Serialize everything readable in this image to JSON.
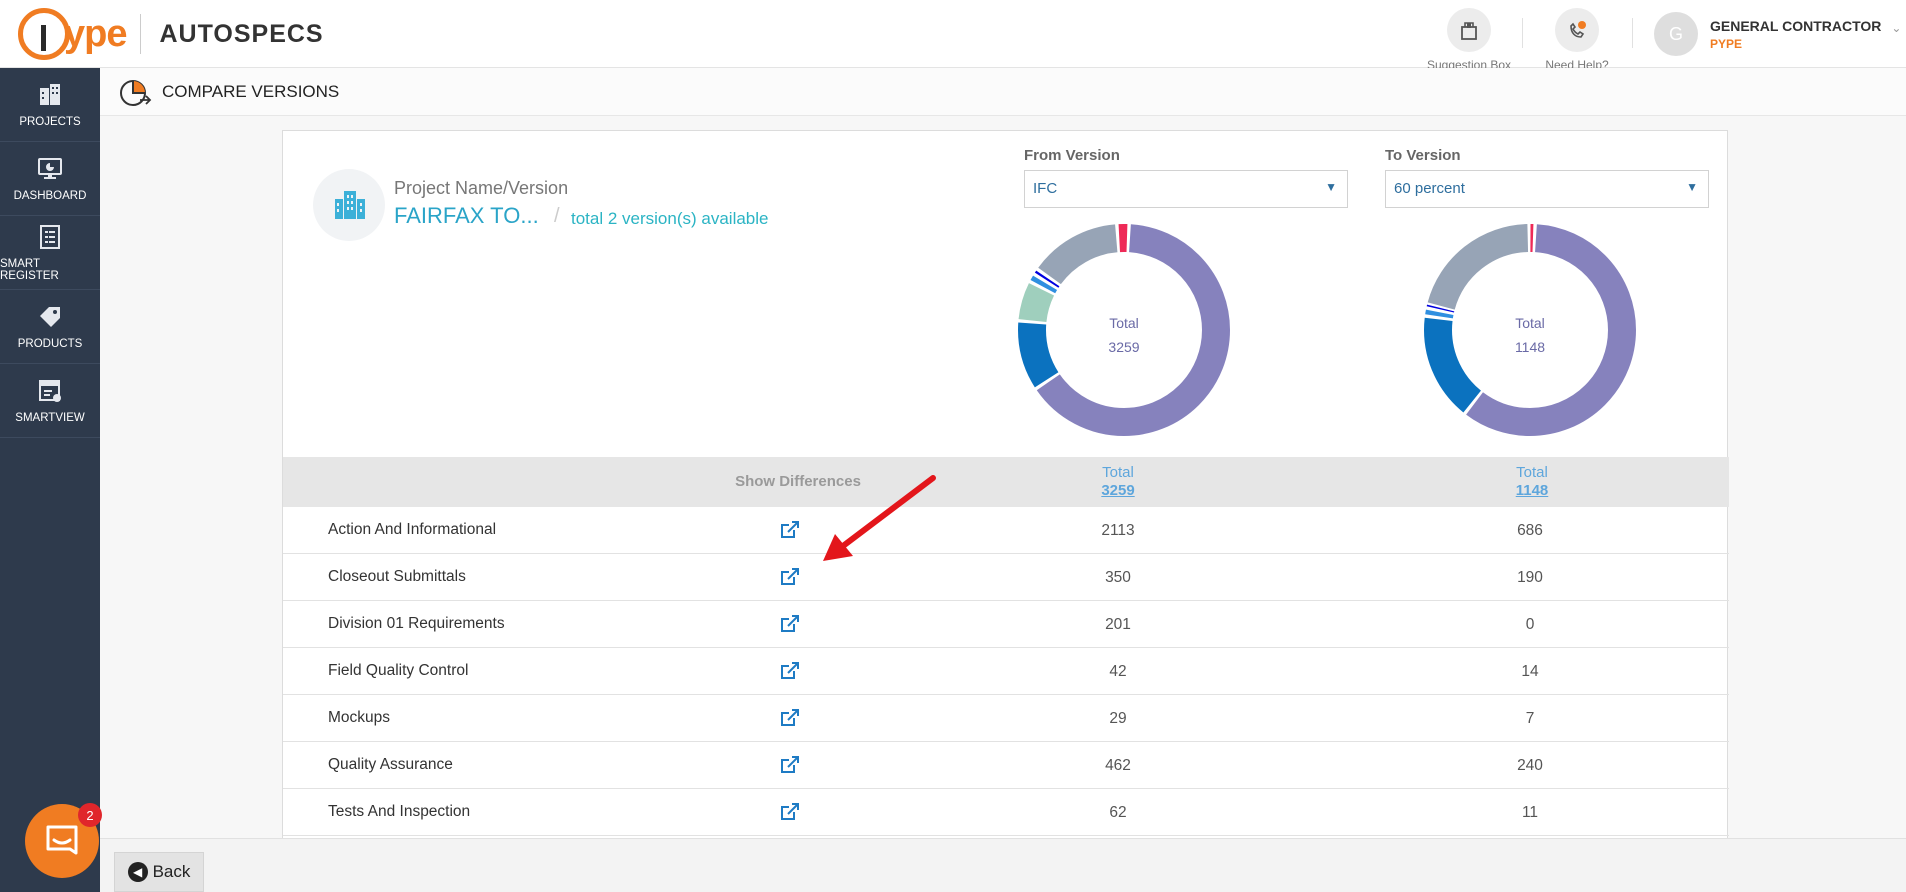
{
  "header": {
    "brand": "ype",
    "app_name": "AUTOSPECS",
    "actions": [
      {
        "label": "Suggestion Box",
        "icon": "suggestion-box-icon"
      },
      {
        "label": "Need Help?",
        "icon": "help-phone-icon"
      }
    ],
    "user": {
      "initial": "G",
      "name": "GENERAL CONTRACTOR",
      "org": "PYPE"
    }
  },
  "sidebar": {
    "items": [
      {
        "label": "PROJECTS",
        "icon": "building-icon"
      },
      {
        "label": "DASHBOARD",
        "icon": "monitor-icon"
      },
      {
        "label": "SMART REGISTER",
        "icon": "register-icon"
      },
      {
        "label": "PRODUCTS",
        "icon": "tag-icon"
      },
      {
        "label": "SMARTVIEW",
        "icon": "smartview-icon"
      }
    ]
  },
  "page": {
    "title": "COMPARE VERSIONS"
  },
  "project": {
    "label": "Project Name/Version",
    "name": "FAIRFAX TO...",
    "separator": "/",
    "total_versions": "total 2 version(s) available"
  },
  "from_version": {
    "label": "From Version",
    "selected": "IFC",
    "total_label": "Total",
    "total_value": "3259"
  },
  "to_version": {
    "label": "To Version",
    "selected": "60 percent",
    "total_label": "Total",
    "total_value": "1148"
  },
  "colors": {
    "purple": "#8682bd",
    "blue": "#0b72bf",
    "mint": "#9fcfbd",
    "sky": "#2f8fe0",
    "navy": "#0000e0",
    "slate": "#97a4b6",
    "red": "#ee2a57",
    "light_blue": "#6cc0d6"
  },
  "table": {
    "show_differences": "Show Differences",
    "col_from": {
      "label": "Total",
      "value": "3259"
    },
    "col_to": {
      "label": "Total",
      "value": "1148"
    },
    "rows": [
      {
        "name": "Action And Informational",
        "from": "2113",
        "to": "686"
      },
      {
        "name": "Closeout Submittals",
        "from": "350",
        "to": "190"
      },
      {
        "name": "Division 01 Requirements",
        "from": "201",
        "to": "0"
      },
      {
        "name": "Field Quality Control",
        "from": "42",
        "to": "14"
      },
      {
        "name": "Mockups",
        "from": "29",
        "to": "7"
      },
      {
        "name": "Quality Assurance",
        "from": "462",
        "to": "240"
      },
      {
        "name": "Tests And Inspection",
        "from": "62",
        "to": "11"
      }
    ]
  },
  "footer": {
    "back_label": "Back",
    "chat_badge": "2"
  }
}
